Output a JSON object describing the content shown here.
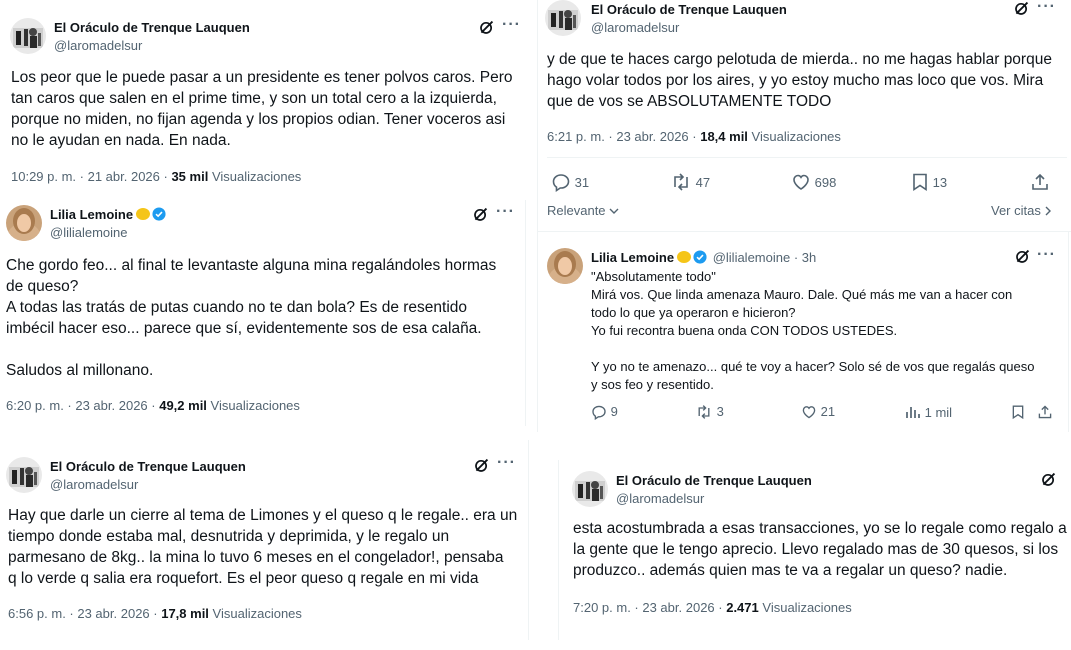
{
  "tweet1": {
    "name": "El Oráculo de Trenque Lauquen",
    "handle": "@laromadelsur",
    "text": "Los peor que le puede pasar a un presidente es tener polvos caros. Pero\ntan caros que salen en el prime time, y son un total cero a la izquierda,\nporque no miden, no fijan agenda y los propios odian. Tener voceros asi\nno le ayudan en nada. En nada.",
    "time": "10:29 p. m. · 21 abr. 2026 ·",
    "views": "35 mil",
    "views_label": "Visualizaciones"
  },
  "tweet2": {
    "name": "Lilia Lemoine",
    "handle": "@lilialemoine",
    "text": "Che gordo feo... al final te levantaste alguna mina regalándoles hormas\nde queso?\nA todas las tratás de putas cuando no te dan bola? Es de resentido\nimbécil hacer eso... parece que sí, evidentemente sos de esa calaña.\n\nSaludos al millonano.",
    "time": "6:20 p. m. · 23 abr. 2026 ·",
    "views": "49,2 mil",
    "views_label": "Visualizaciones"
  },
  "tweet3": {
    "name": "El Oráculo de Trenque Lauquen",
    "handle": "@laromadelsur",
    "text": "Hay que darle un cierre al tema de Limones y el queso q le regale.. era un\ntiempo donde estaba mal, desnutrida y deprimida, y le regalo un\nparmesano de 8kg.. la mina lo tuvo 6 meses en el congelador!, pensaba\nq lo verde q salia era roquefort. Es el peor queso q regale en mi vida",
    "time": "6:56 p. m. · 23 abr. 2026 ·",
    "views": "17,8 mil",
    "views_label": "Visualizaciones"
  },
  "tweet4": {
    "name": "El Oráculo de Trenque Lauquen",
    "handle": "@laromadelsur",
    "text": "y de que te haces cargo pelotuda de mierda.. no me hagas hablar porque\nhago volar todos por los aires, y yo estoy mucho mas loco que vos. Mira\nque de vos se ABSOLUTAMENTE TODO",
    "time": "6:21 p. m. · 23 abr. 2026 ·",
    "views": "18,4 mil",
    "views_label": "Visualizaciones",
    "replies": "31",
    "retweets": "47",
    "likes": "698",
    "bookmarks": "13",
    "sort_label": "Relevante",
    "quotes_label": "Ver citas"
  },
  "reply": {
    "name": "Lilia Lemoine",
    "handle": "@lilialemoine · 3h",
    "text": "\"Absolutamente todo\"\nMirá vos. Que linda amenaza Mauro. Dale. Qué más me van a hacer con\ntodo lo que ya operaron e hicieron?\nYo fui recontra buena onda CON TODOS USTEDES.\n\nY yo no te amenazo... qué te voy a hacer? Solo sé de vos que regalás queso\ny sos feo y resentido.",
    "replies": "9",
    "retweets": "3",
    "likes": "21",
    "views": "1 mil"
  },
  "tweet5": {
    "name": "El Oráculo de Trenque Lauquen",
    "handle": "@laromadelsur",
    "text": "esta acostumbrada a esas transacciones, yo se lo regale como regalo a\nla gente que le tengo aprecio. Llevo regalado mas de 30 quesos, si los\nproduzco.. además quien mas te va a regalar un queso? nadie.",
    "time": "7:20 p. m. · 23 abr. 2026 ·",
    "views": "2.471",
    "views_label": "Visualizaciones"
  },
  "colors": {
    "text": "#0f1419",
    "muted": "#536471",
    "verified": "#1d9bf0",
    "divider": "#eff3f4"
  },
  "icons": [
    "grok-icon",
    "more-icon",
    "reply-icon",
    "retweet-icon",
    "like-icon",
    "bookmark-icon",
    "share-icon",
    "views-icon",
    "verified-icon",
    "lemon-emoji"
  ]
}
